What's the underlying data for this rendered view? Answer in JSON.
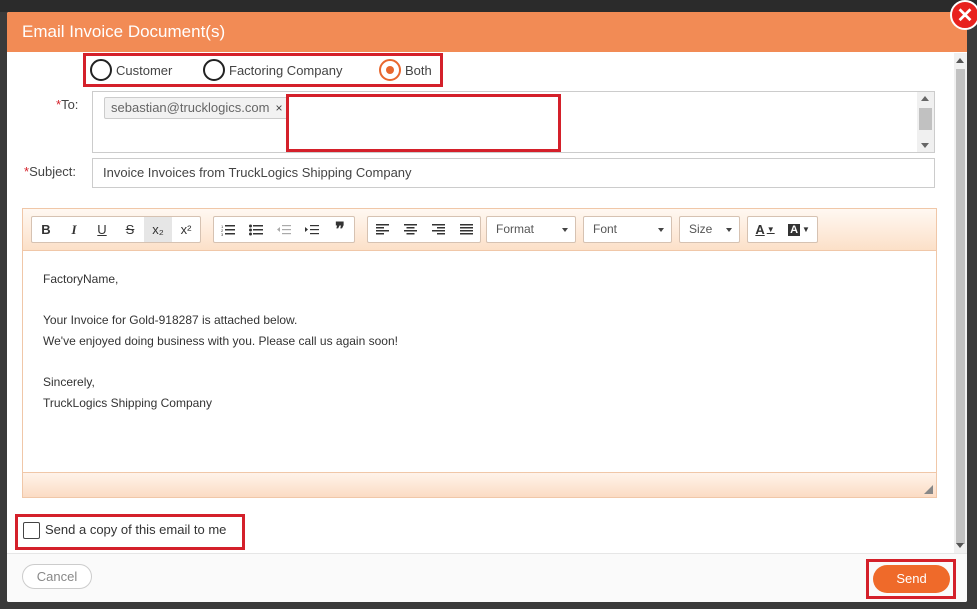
{
  "dialog": {
    "title": "Email Invoice Document(s)",
    "close_symbol": "✕"
  },
  "recipient_type": {
    "options": [
      "Customer",
      "Factoring Company",
      "Both"
    ],
    "selected": "Both"
  },
  "to": {
    "required_mark": "*",
    "label": "To:",
    "tags": [
      {
        "email": "sebastian@trucklogics.com",
        "remove": "×"
      }
    ]
  },
  "subject": {
    "required_mark": "*",
    "label": "Subject:",
    "value": "Invoice Invoices  from TruckLogics Shipping Company"
  },
  "editor": {
    "toolbar": {
      "bold": "B",
      "italic": "I",
      "underline": "U",
      "strike": "S",
      "subscript": "x₂",
      "superscript": "x²",
      "format": "Format",
      "font": "Font",
      "size": "Size",
      "text_color": "A",
      "bg_color": "A"
    },
    "body": [
      "FactoryName,",
      "",
      "Your Invoice for Gold-918287 is attached below.",
      "We've enjoyed doing business with you. Please call us again soon!",
      "",
      "Sincerely,",
      "TruckLogics Shipping Company"
    ]
  },
  "copy_to_me": {
    "label": "Send a copy of this email to me",
    "checked": false
  },
  "footer": {
    "cancel_label": "Cancel",
    "send_label": "Send"
  },
  "colors": {
    "header": "#f28b55",
    "accent": "#ef6a2a",
    "highlight": "#d4202a"
  }
}
